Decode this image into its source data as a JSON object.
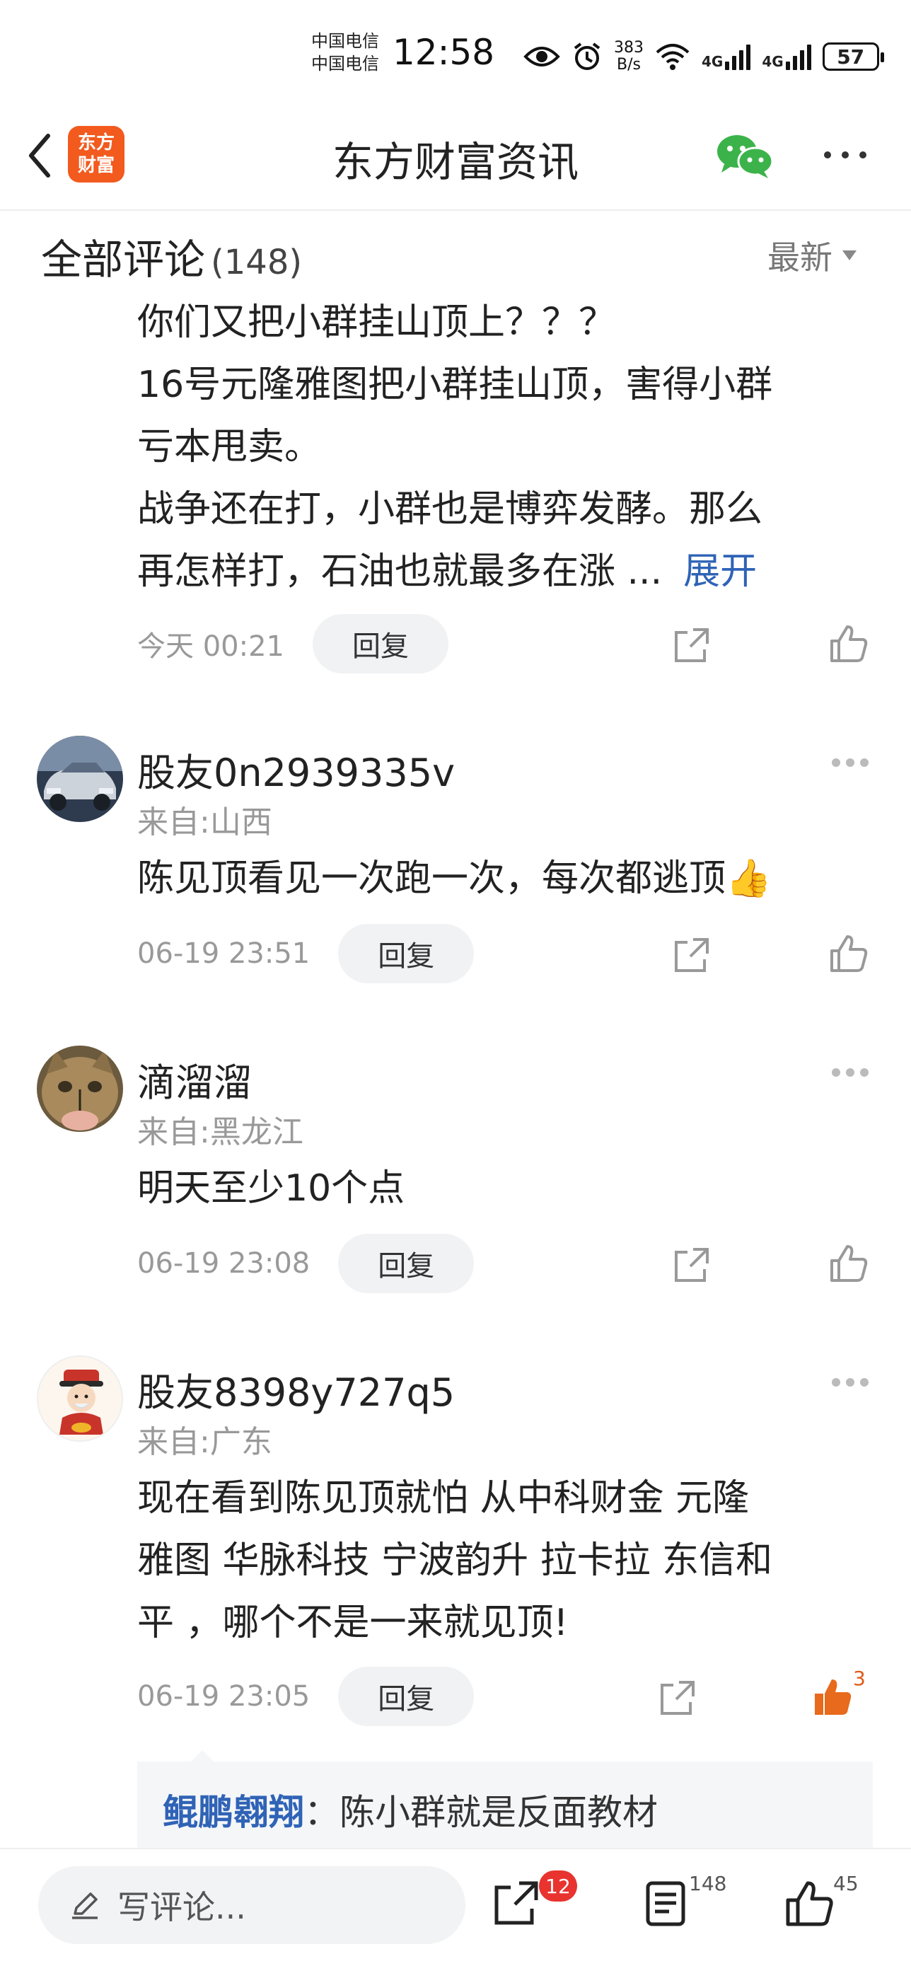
{
  "status_bar": {
    "carrier_1": "中国电信",
    "carrier_2": "中国电信",
    "time": "12:58",
    "net_speed_value": "383",
    "net_speed_unit": "B/s",
    "signal_1": "4G",
    "signal_2": "4G",
    "battery": "57"
  },
  "header": {
    "logo_line1": "东方",
    "logo_line2": "财富",
    "title": "东方财富资讯"
  },
  "comments_section": {
    "title": "全部评论",
    "count": "(148)",
    "sort_label": "最新"
  },
  "comments": [
    {
      "text_lines": [
        "你们又把小群挂山顶上？？？",
        "16号元隆雅图把小群挂山顶，害得小群",
        "亏本甩卖。",
        "战争还在打，小群也是博弈发酵。那么",
        "再怎样打，石油也就最多在涨 ..."
      ],
      "expand_label": "展开",
      "time": "今天 00:21",
      "reply_label": "回复"
    },
    {
      "username": "股友0n2939335v",
      "location": "来自:山西",
      "text": "陈见顶看见一次跑一次，每次都逃顶👍",
      "time": "06-19 23:51",
      "reply_label": "回复"
    },
    {
      "username": "滴溜溜",
      "location": "来自:黑龙江",
      "text": "明天至少10个点",
      "time": "06-19 23:08",
      "reply_label": "回复"
    },
    {
      "username": "股友8398y727q5",
      "location": "来自:广东",
      "text_lines": [
        "现在看到陈见顶就怕 从中科财金 元隆",
        "雅图 华脉科技 宁波韵升  拉卡拉 东信和",
        "平 ，哪个不是一来就见顶!"
      ],
      "time": "06-19 23:05",
      "reply_label": "回复",
      "like_count": "3",
      "sub_reply": {
        "name": "鲲鹏翱翔",
        "separator": "：",
        "text": "陈小群就是反面教材"
      }
    }
  ],
  "bottom_bar": {
    "write_placeholder": "写评论...",
    "share_badge": "12",
    "comment_count": "148",
    "like_count": "45"
  },
  "colors": {
    "brand_orange": "#f25a1e",
    "link_blue": "#2f63b6",
    "like_orange": "#e86a1c",
    "badge_red": "#e8332f",
    "wechat_green": "#3cb34a"
  },
  "icons": [
    "back-icon",
    "wechat-icon",
    "more-icon",
    "share-icon",
    "like-icon",
    "edit-icon",
    "comment-list-icon",
    "eye-icon",
    "alarm-icon",
    "wifi-icon"
  ]
}
